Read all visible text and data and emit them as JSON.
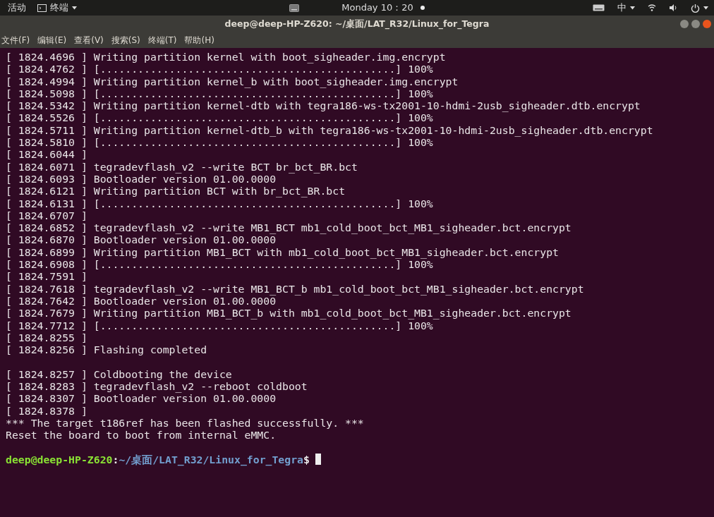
{
  "top_bar": {
    "activities": "活动",
    "app_menu": "终端",
    "clock": "Monday 10：20",
    "input_method": "中"
  },
  "window": {
    "title": "deep@deep-HP-Z620: ~/桌面/LAT_R32/Linux_for_Tegra"
  },
  "menu": [
    "文件(F)",
    "编辑(E)",
    "查看(V)",
    "搜索(S)",
    "终端(T)",
    "帮助(H)"
  ],
  "terminal": {
    "blocks": [
      [
        "[ 1824.4696 ] Writing partition kernel with boot_sigheader.img.encrypt",
        "[ 1824.4762 ] [...............................................] 100%",
        "[ 1824.4994 ] Writing partition kernel_b with boot_sigheader.img.encrypt",
        "[ 1824.5098 ] [...............................................] 100%",
        "[ 1824.5342 ] Writing partition kernel-dtb with tegra186-ws-tx2001-10-hdmi-2usb_sigheader.dtb.encrypt",
        "[ 1824.5526 ] [...............................................] 100%",
        "[ 1824.5711 ] Writing partition kernel-dtb_b with tegra186-ws-tx2001-10-hdmi-2usb_sigheader.dtb.encrypt",
        "[ 1824.5810 ] [...............................................] 100%",
        "[ 1824.6044 ]",
        "[ 1824.6071 ] tegradevflash_v2 --write BCT br_bct_BR.bct",
        "[ 1824.6093 ] Bootloader version 01.00.0000",
        "[ 1824.6121 ] Writing partition BCT with br_bct_BR.bct",
        "[ 1824.6131 ] [...............................................] 100%",
        "[ 1824.6707 ]",
        "[ 1824.6852 ] tegradevflash_v2 --write MB1_BCT mb1_cold_boot_bct_MB1_sigheader.bct.encrypt",
        "[ 1824.6870 ] Bootloader version 01.00.0000",
        "[ 1824.6899 ] Writing partition MB1_BCT with mb1_cold_boot_bct_MB1_sigheader.bct.encrypt",
        "[ 1824.6908 ] [...............................................] 100%",
        "[ 1824.7591 ]",
        "[ 1824.7618 ] tegradevflash_v2 --write MB1_BCT_b mb1_cold_boot_bct_MB1_sigheader.bct.encrypt",
        "[ 1824.7642 ] Bootloader version 01.00.0000",
        "[ 1824.7679 ] Writing partition MB1_BCT_b with mb1_cold_boot_bct_MB1_sigheader.bct.encrypt",
        "[ 1824.7712 ] [...............................................] 100%",
        "[ 1824.8255 ]",
        "[ 1824.8256 ] Flashing completed"
      ],
      [
        "[ 1824.8257 ] Coldbooting the device",
        "[ 1824.8283 ] tegradevflash_v2 --reboot coldboot",
        "[ 1824.8307 ] Bootloader version 01.00.0000",
        "[ 1824.8378 ]",
        "*** The target t186ref has been flashed successfully. ***",
        "Reset the board to boot from internal eMMC."
      ]
    ],
    "prompt": {
      "user_host": "deep@deep-HP-Z620",
      "separator": ":",
      "path": "~/桌面/LAT_R32/Linux_for_Tegra",
      "symbol": "$"
    }
  }
}
